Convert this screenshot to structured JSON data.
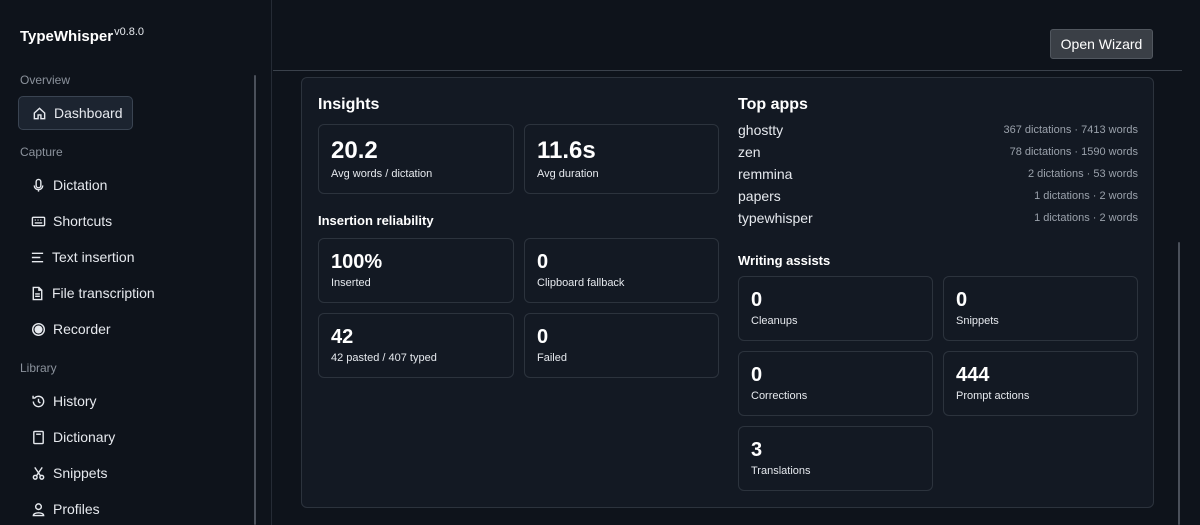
{
  "app": {
    "name": "TypeWhisper",
    "version": "v0.8.0"
  },
  "sidebar": {
    "sections": {
      "overview": "Overview",
      "capture": "Capture",
      "library": "Library"
    },
    "items": [
      {
        "label": "Dashboard",
        "icon": "home-icon",
        "active": true
      },
      {
        "label": "Dictation",
        "icon": "microphone-icon"
      },
      {
        "label": "Shortcuts",
        "icon": "keyboard-icon"
      },
      {
        "label": "Text insertion",
        "icon": "text-lines-icon"
      },
      {
        "label": "File transcription",
        "icon": "file-icon"
      },
      {
        "label": "Recorder",
        "icon": "record-icon"
      },
      {
        "label": "History",
        "icon": "history-icon"
      },
      {
        "label": "Dictionary",
        "icon": "book-icon"
      },
      {
        "label": "Snippets",
        "icon": "scissors-icon"
      },
      {
        "label": "Profiles",
        "icon": "user-icon"
      }
    ]
  },
  "header": {
    "wizard_label": "Open Wizard"
  },
  "insights": {
    "title": "Insights",
    "avg_words_value": "20.2",
    "avg_words_label": "Avg words / dictation",
    "avg_duration_value": "11.6s",
    "avg_duration_label": "Avg duration"
  },
  "reliability": {
    "title": "Insertion reliability",
    "inserted_value": "100%",
    "inserted_label": "Inserted",
    "clipboard_value": "0",
    "clipboard_label": "Clipboard fallback",
    "pasted_value": "42",
    "pasted_label": "42 pasted / 407 typed",
    "failed_value": "0",
    "failed_label": "Failed"
  },
  "top_apps": {
    "title": "Top apps",
    "apps": [
      {
        "name": "ghostty",
        "stat": "367 dictations · 7413 words"
      },
      {
        "name": "zen",
        "stat": "78 dictations · 1590 words"
      },
      {
        "name": "remmina",
        "stat": "2 dictations · 53 words"
      },
      {
        "name": "papers",
        "stat": "1 dictations · 2 words"
      },
      {
        "name": "typewhisper",
        "stat": "1 dictations · 2 words"
      }
    ]
  },
  "assists": {
    "title": "Writing assists",
    "cleanups_value": "0",
    "cleanups_label": "Cleanups",
    "snippets_value": "0",
    "snippets_label": "Snippets",
    "corrections_value": "0",
    "corrections_label": "Corrections",
    "prompt_value": "444",
    "prompt_label": "Prompt actions",
    "translations_value": "3",
    "translations_label": "Translations"
  }
}
